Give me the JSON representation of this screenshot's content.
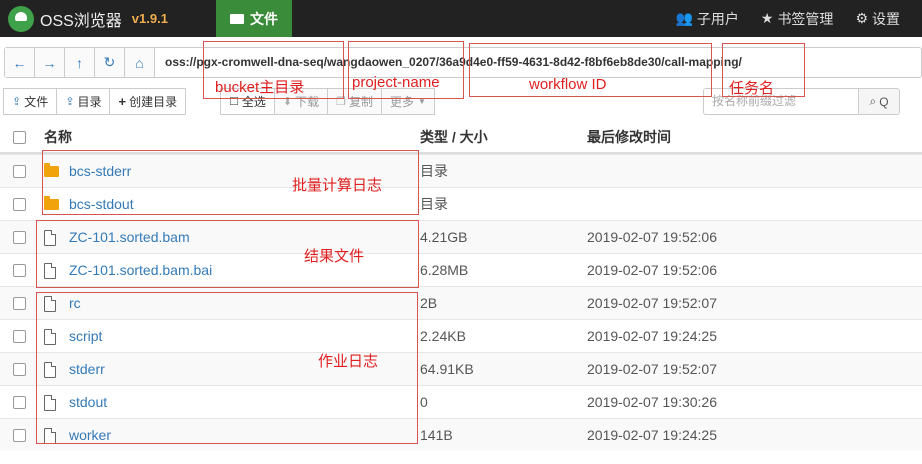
{
  "navbar": {
    "brand": "OSS浏览器",
    "version": "v1.9.1",
    "files_tab": "文件",
    "subusers": "子用户",
    "bookmarks": "书签管理",
    "settings": "设置"
  },
  "address": {
    "path": "oss://pgx-cromwell-dna-seq/wangdaowen_0207/36a9d4e0-ff59-4631-8d42-f8bf6eb8de30/call-mapping/"
  },
  "toolbar": {
    "file": "文件",
    "dir": "目录",
    "create_dir": "创建目录",
    "select_all": "全选",
    "download": "下载",
    "copy": "复制",
    "more": "更多",
    "search_placeholder": "按名称前缀过滤",
    "search_icon_label": "Q"
  },
  "table": {
    "headers": {
      "name": "名称",
      "type": "类型 / 大小",
      "time": "最后修改时间"
    },
    "rows": [
      {
        "name": "bcs-stderr",
        "kind": "folder",
        "size": "目录",
        "time": ""
      },
      {
        "name": "bcs-stdout",
        "kind": "folder",
        "size": "目录",
        "time": ""
      },
      {
        "name": "ZC-101.sorted.bam",
        "kind": "file",
        "size": "4.21GB",
        "time": "2019-02-07 19:52:06"
      },
      {
        "name": "ZC-101.sorted.bam.bai",
        "kind": "file",
        "size": "6.28MB",
        "time": "2019-02-07 19:52:06"
      },
      {
        "name": "rc",
        "kind": "file",
        "size": "2B",
        "time": "2019-02-07 19:52:07"
      },
      {
        "name": "script",
        "kind": "file",
        "size": "2.24KB",
        "time": "2019-02-07 19:24:25"
      },
      {
        "name": "stderr",
        "kind": "file",
        "size": "64.91KB",
        "time": "2019-02-07 19:52:07"
      },
      {
        "name": "stdout",
        "kind": "file",
        "size": "0",
        "time": "2019-02-07 19:30:26"
      },
      {
        "name": "worker",
        "kind": "file",
        "size": "141B",
        "time": "2019-02-07 19:24:25"
      }
    ]
  },
  "annotations": {
    "bucket": "bucket主目录",
    "project": "project-name",
    "workflow": "workflow ID",
    "task": "任务名",
    "batch_logs": "批量计算日志",
    "result_files": "结果文件",
    "job_logs": "作业日志"
  },
  "colors": {
    "navbar_bg": "#222222",
    "active_tab": "#3a8b3a",
    "link": "#337ab7",
    "annotation": "#e02020",
    "version": "#f0ad4e"
  }
}
